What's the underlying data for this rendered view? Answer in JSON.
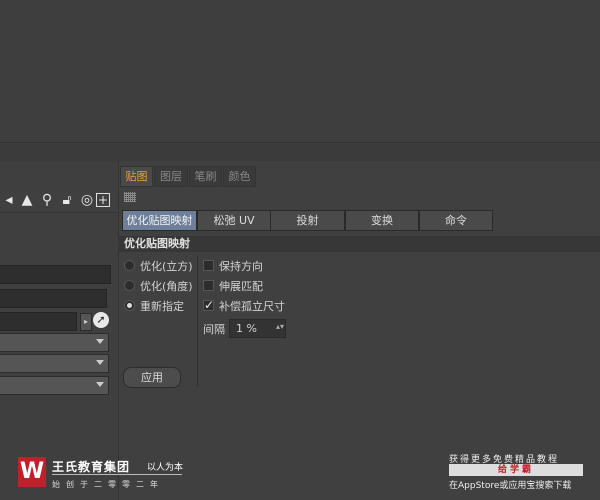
{
  "tabs": [
    {
      "label": "贴图",
      "active": true
    },
    {
      "label": "图层",
      "active": false
    },
    {
      "label": "笔刷",
      "active": false
    },
    {
      "label": "颜色",
      "active": false
    }
  ],
  "subtabs": [
    {
      "label": "优化贴图映射",
      "active": true
    },
    {
      "label": "松弛 UV",
      "active": false
    },
    {
      "label": "投射",
      "active": false
    },
    {
      "label": "变换",
      "active": false
    },
    {
      "label": "命令",
      "active": false
    }
  ],
  "section_title": "优化贴图映射",
  "radios": [
    {
      "label": "优化(立方)",
      "selected": false
    },
    {
      "label": "优化(角度)",
      "selected": false
    },
    {
      "label": "重新指定",
      "selected": true
    }
  ],
  "checks": [
    {
      "label": "保持方向",
      "checked": false
    },
    {
      "label": "伸展匹配",
      "checked": false
    },
    {
      "label": "补偿孤立尺寸",
      "checked": true
    }
  ],
  "interval": {
    "label": "间隔",
    "value": "1 %"
  },
  "apply_label": "应用",
  "left_toolbar_icons": [
    "arrow-cursor-icon",
    "search-icon",
    "lock-icon",
    "target-icon",
    "add-icon"
  ],
  "watermark": {
    "logo_letter": "W",
    "brand": "王氏教育集团",
    "tag": "以人为本",
    "slogan": "始创于二零零二年",
    "right_line1": "获得更多免费精品教程",
    "right_line2": "给学霸",
    "right_line3": "在AppStore或应用宝搜索下载"
  },
  "colors": {
    "active_tab_text": "#e8a534",
    "active_subtab": "#6d7f9a",
    "logo_red": "#c0202a"
  }
}
